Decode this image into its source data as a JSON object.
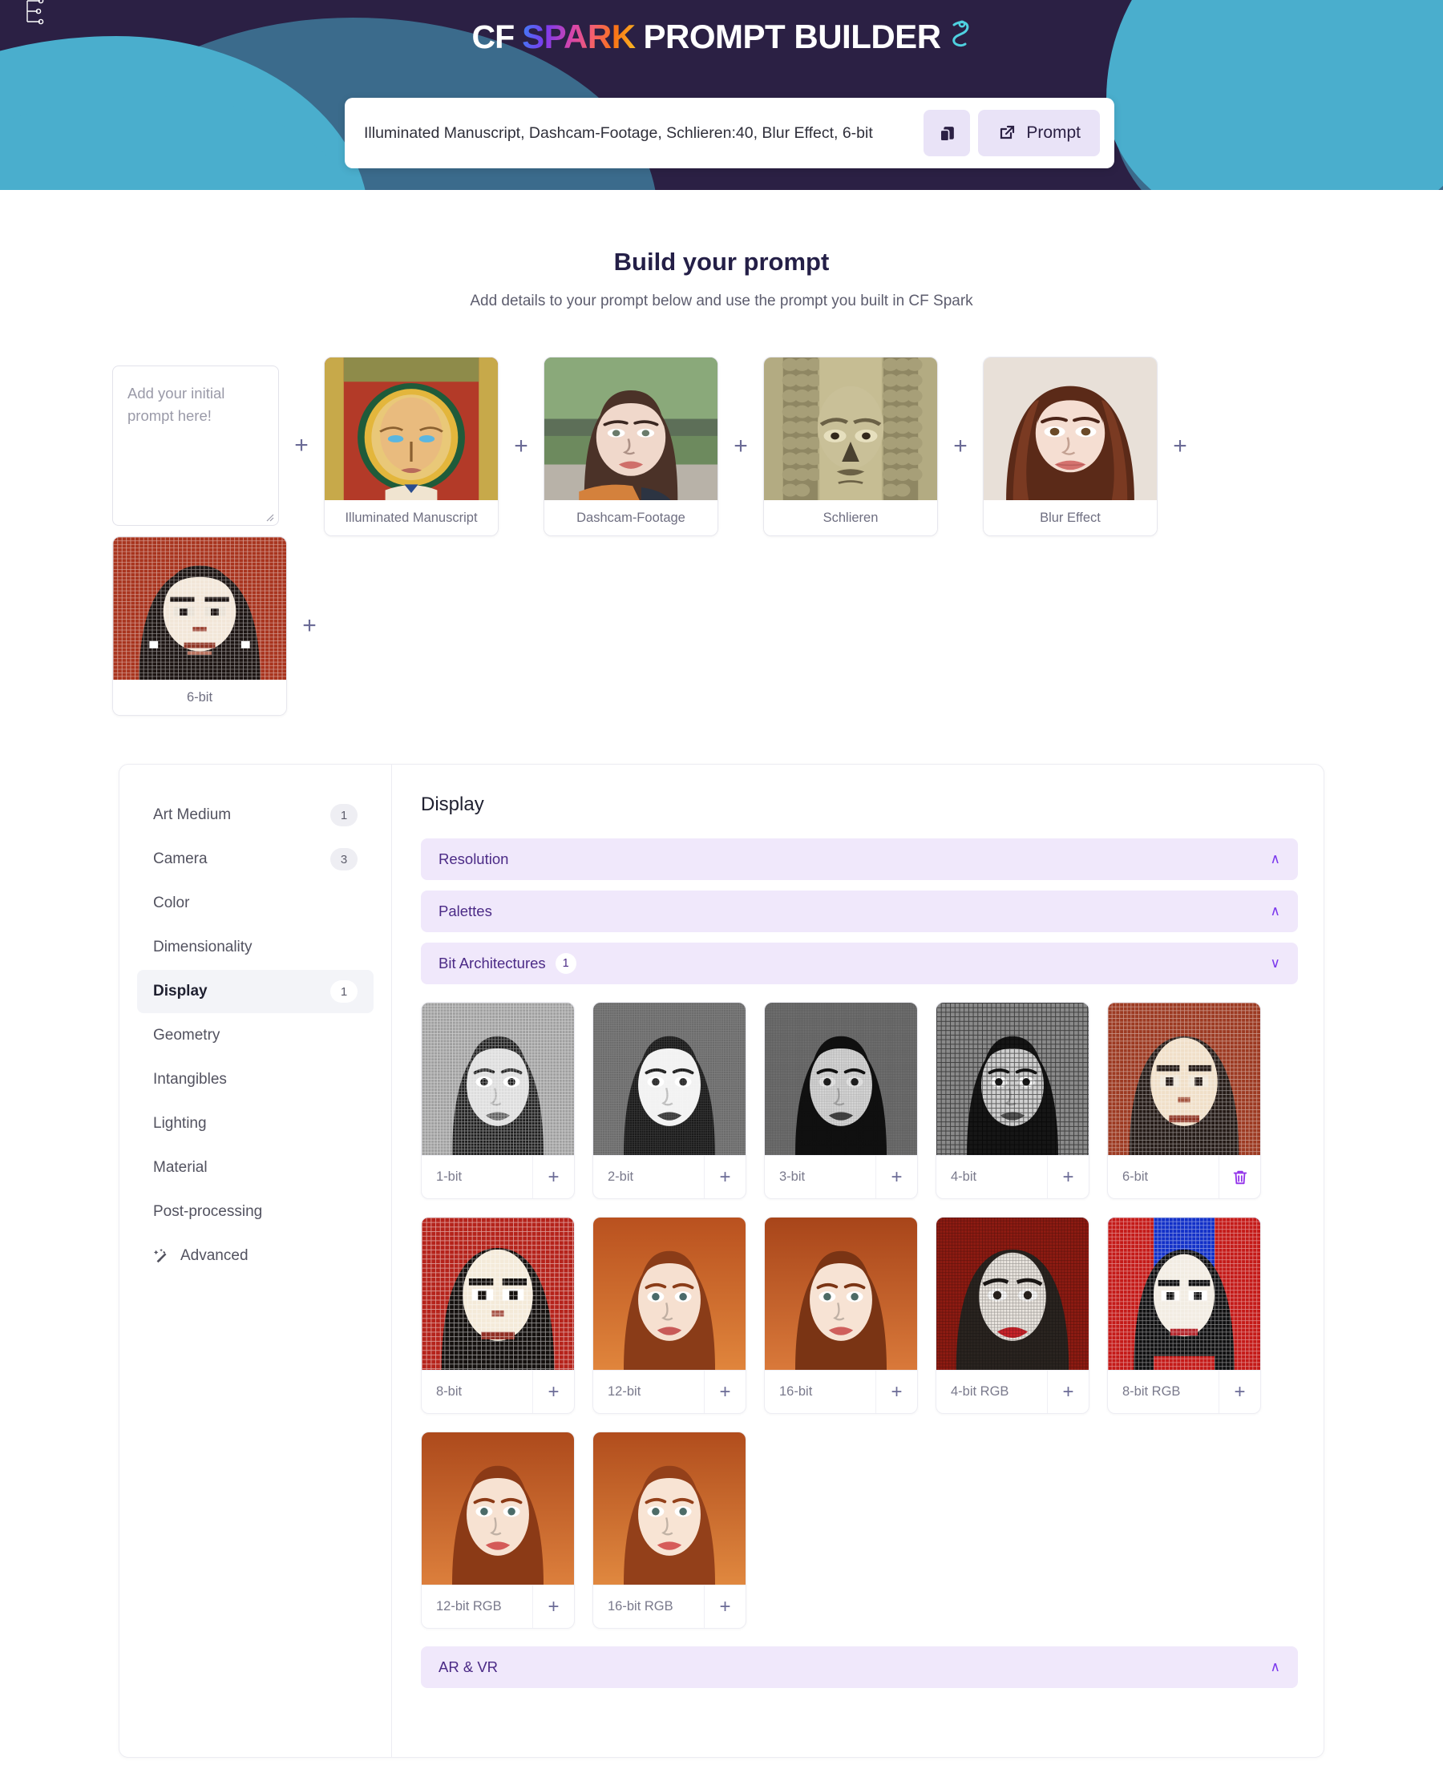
{
  "header": {
    "logo": {
      "cf": "CF",
      "spark": "SPARK",
      "builder": "PROMPT BUILDER"
    },
    "prompt_value": "Illuminated Manuscript, Dashcam-Footage, Schlieren:40, Blur Effect, 6-bit",
    "copy_button_name": "copy-icon",
    "prompt_button_label": "Prompt",
    "colors": {
      "bg": "#2b2044",
      "teal": "#4aaecd",
      "steel": "#3b6b8c",
      "accent": "#e9e3f7"
    }
  },
  "build": {
    "title": "Build your prompt",
    "subtitle": "Add details to your prompt below and use the prompt you built in CF Spark",
    "textarea_placeholder": "Add your initial prompt here!",
    "separator": "+",
    "chips": [
      {
        "label": "Illuminated Manuscript",
        "thumb": "illuminated-manuscript"
      },
      {
        "label": "Dashcam-Footage",
        "thumb": "dashcam-footage"
      },
      {
        "label": "Schlieren",
        "thumb": "schlieren"
      },
      {
        "label": "Blur Effect",
        "thumb": "blur-effect"
      },
      {
        "label": "6-bit",
        "thumb": "six-bit"
      }
    ]
  },
  "sidebar": {
    "items": [
      {
        "label": "Art Medium",
        "badge": "1",
        "active": false
      },
      {
        "label": "Camera",
        "badge": "3",
        "active": false
      },
      {
        "label": "Color",
        "badge": "",
        "active": false
      },
      {
        "label": "Dimensionality",
        "badge": "",
        "active": false
      },
      {
        "label": "Display",
        "badge": "1",
        "active": true
      },
      {
        "label": "Geometry",
        "badge": "",
        "active": false
      },
      {
        "label": "Intangibles",
        "badge": "",
        "active": false
      },
      {
        "label": "Lighting",
        "badge": "",
        "active": false
      },
      {
        "label": "Material",
        "badge": "",
        "active": false
      },
      {
        "label": "Post-processing",
        "badge": "",
        "active": false
      },
      {
        "label": "Advanced",
        "badge": "",
        "active": false,
        "icon": "magic-wand-icon"
      }
    ]
  },
  "content": {
    "title": "Display",
    "accordions_top": [
      {
        "label": "Resolution",
        "badge": "",
        "chevron": "∧",
        "expanded": false
      },
      {
        "label": "Palettes",
        "badge": "",
        "chevron": "∧",
        "expanded": false
      },
      {
        "label": "Bit Architectures",
        "badge": "1",
        "chevron": "∨",
        "expanded": true
      }
    ],
    "accordions_bottom": [
      {
        "label": "AR & VR",
        "badge": "",
        "chevron": "∧",
        "expanded": false
      }
    ],
    "tiles": [
      {
        "label": "1-bit",
        "action": "add",
        "action_glyph": "+",
        "style": "halftone-bw"
      },
      {
        "label": "2-bit",
        "action": "add",
        "action_glyph": "+",
        "style": "etch-bw"
      },
      {
        "label": "3-bit",
        "action": "add",
        "action_glyph": "+",
        "style": "noise-bw"
      },
      {
        "label": "4-bit",
        "action": "add",
        "action_glyph": "+",
        "style": "scan-bw"
      },
      {
        "label": "6-bit",
        "action": "remove",
        "action_glyph": "trash-icon",
        "style": "pixel-red"
      },
      {
        "label": "8-bit",
        "action": "add",
        "action_glyph": "+",
        "style": "pixel-red2"
      },
      {
        "label": "12-bit",
        "action": "add",
        "action_glyph": "+",
        "style": "warm-photo"
      },
      {
        "label": "16-bit",
        "action": "add",
        "action_glyph": "+",
        "style": "warm-photo2"
      },
      {
        "label": "4-bit RGB",
        "action": "add",
        "action_glyph": "+",
        "style": "red-grid"
      },
      {
        "label": "8-bit RGB",
        "action": "add",
        "action_glyph": "+",
        "style": "rgb-pixel"
      },
      {
        "label": "12-bit RGB",
        "action": "add",
        "action_glyph": "+",
        "style": "warm-photo3"
      },
      {
        "label": "16-bit RGB",
        "action": "add",
        "action_glyph": "+",
        "style": "warm-photo4"
      }
    ]
  }
}
